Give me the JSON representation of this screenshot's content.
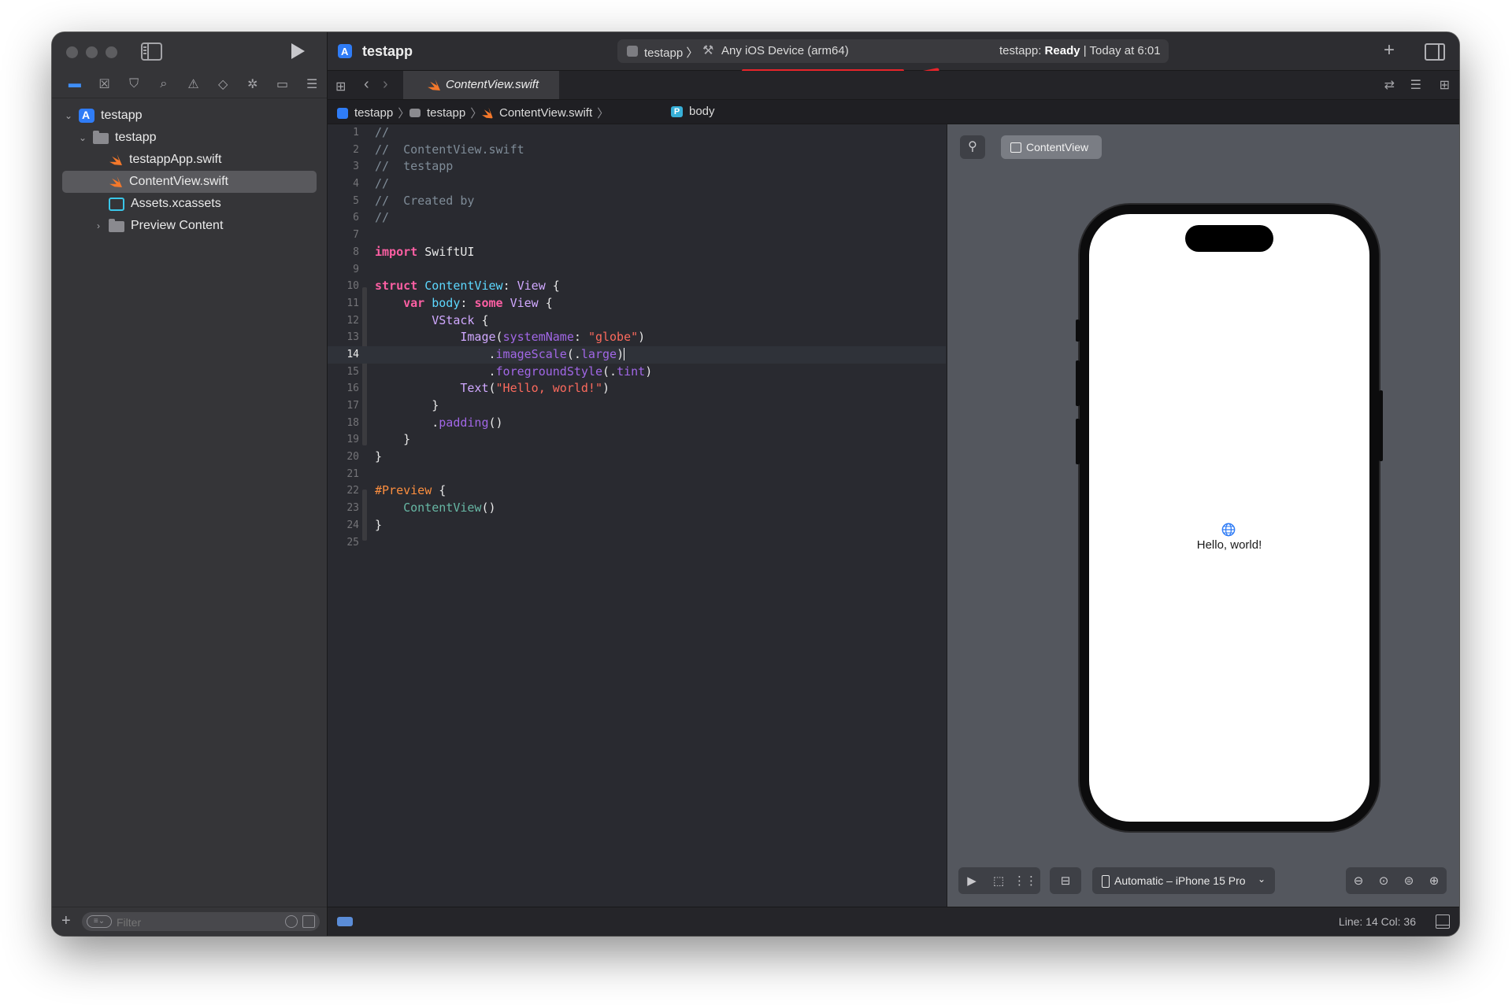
{
  "toolbar": {
    "project_name": "testapp",
    "scheme_target": "testapp",
    "scheme_device": "Any iOS Device (arm64)",
    "status_prefix": "testapp:",
    "status_state": "Ready",
    "status_suffix": "| Today at 6:01"
  },
  "navigator": {
    "tab_icons": [
      "folder-icon",
      "source-control-icon",
      "bookmark-icon",
      "find-icon",
      "warning-icon",
      "test-icon",
      "debug-icon",
      "breakpoint-icon",
      "report-icon"
    ],
    "items": [
      {
        "label": "testapp",
        "type": "project"
      },
      {
        "label": "testapp",
        "type": "folder"
      },
      {
        "label": "testappApp.swift",
        "type": "swift"
      },
      {
        "label": "ContentView.swift",
        "type": "swift",
        "selected": true
      },
      {
        "label": "Assets.xcassets",
        "type": "assets"
      },
      {
        "label": "Preview Content",
        "type": "folder"
      }
    ],
    "filter_placeholder": "Filter"
  },
  "editor_tab": {
    "label": "ContentView.swift"
  },
  "jumpbar": [
    "testapp",
    "testapp",
    "ContentView.swift",
    "body"
  ],
  "code": {
    "current_line": 14,
    "lines": [
      {
        "n": "1",
        "t": [
          [
            "cm",
            "//"
          ]
        ]
      },
      {
        "n": "2",
        "t": [
          [
            "cm",
            "//  ContentView.swift"
          ]
        ]
      },
      {
        "n": "3",
        "t": [
          [
            "cm",
            "//  testapp"
          ]
        ]
      },
      {
        "n": "4",
        "t": [
          [
            "cm",
            "//"
          ]
        ]
      },
      {
        "n": "5",
        "t": [
          [
            "cm",
            "//  Created by"
          ]
        ]
      },
      {
        "n": "6",
        "t": [
          [
            "cm",
            "//"
          ]
        ]
      },
      {
        "n": "7",
        "t": []
      },
      {
        "n": "8",
        "t": [
          [
            "kw",
            "import"
          ],
          [
            "",
            " SwiftUI"
          ]
        ]
      },
      {
        "n": "9",
        "t": []
      },
      {
        "n": "10",
        "t": [
          [
            "kw",
            "struct"
          ],
          [
            "",
            " "
          ],
          [
            "td",
            "ContentView"
          ],
          [
            "",
            ": "
          ],
          [
            "ty",
            "View"
          ],
          [
            "",
            " {"
          ]
        ]
      },
      {
        "n": "11",
        "t": [
          [
            "",
            "    "
          ],
          [
            "kw",
            "var"
          ],
          [
            "",
            " "
          ],
          [
            "td",
            "body"
          ],
          [
            "",
            ": "
          ],
          [
            "kw",
            "some"
          ],
          [
            "",
            " "
          ],
          [
            "ty",
            "View"
          ],
          [
            "",
            " {"
          ]
        ]
      },
      {
        "n": "12",
        "t": [
          [
            "",
            "        "
          ],
          [
            "ty",
            "VStack"
          ],
          [
            "",
            " {"
          ]
        ]
      },
      {
        "n": "13",
        "t": [
          [
            "",
            "            "
          ],
          [
            "ty",
            "Image"
          ],
          [
            "",
            "("
          ],
          [
            "pa",
            "systemName"
          ],
          [
            "",
            ": "
          ],
          [
            "st",
            "\"globe\""
          ],
          [
            "",
            ")"
          ]
        ]
      },
      {
        "n": "14",
        "t": [
          [
            "",
            "                ."
          ],
          [
            "me",
            "imageScale"
          ],
          [
            "",
            "(."
          ],
          [
            "me",
            "large"
          ],
          [
            "",
            ")"
          ]
        ]
      },
      {
        "n": "15",
        "t": [
          [
            "",
            "                ."
          ],
          [
            "me",
            "foregroundStyle"
          ],
          [
            "",
            "(."
          ],
          [
            "me",
            "tint"
          ],
          [
            "",
            ")"
          ]
        ]
      },
      {
        "n": "16",
        "t": [
          [
            "",
            "            "
          ],
          [
            "ty",
            "Text"
          ],
          [
            "",
            "("
          ],
          [
            "st",
            "\"Hello, world!\""
          ],
          [
            "",
            ")"
          ]
        ]
      },
      {
        "n": "17",
        "t": [
          [
            "",
            "        }"
          ]
        ]
      },
      {
        "n": "18",
        "t": [
          [
            "",
            "        ."
          ],
          [
            "me",
            "padding"
          ],
          [
            "",
            "()"
          ]
        ]
      },
      {
        "n": "19",
        "t": [
          [
            "",
            "    }"
          ]
        ]
      },
      {
        "n": "20",
        "t": [
          [
            "",
            "}"
          ]
        ]
      },
      {
        "n": "21",
        "t": []
      },
      {
        "n": "22",
        "t": [
          [
            "attr",
            "#Preview"
          ],
          [
            "",
            " {"
          ]
        ]
      },
      {
        "n": "23",
        "t": [
          [
            "",
            "    "
          ],
          [
            "fn",
            "ContentView"
          ],
          [
            "",
            "()"
          ]
        ]
      },
      {
        "n": "24",
        "t": [
          [
            "",
            "}"
          ]
        ]
      },
      {
        "n": "25",
        "t": []
      }
    ]
  },
  "canvas": {
    "preview_chip": "ContentView",
    "preview_text": "Hello, world!",
    "device_selector": "Automatic – iPhone 15 Pro"
  },
  "statusbar": {
    "line_col": "Line: 14  Col: 36"
  },
  "colors": {
    "accent": "#3f8ef7",
    "annotation": "#e8242a"
  }
}
